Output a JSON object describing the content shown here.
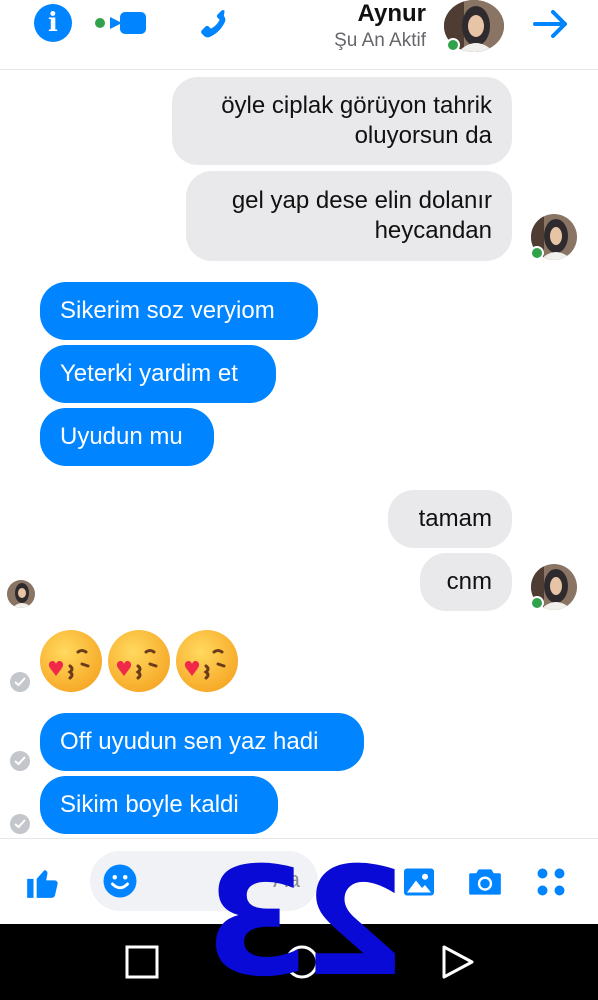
{
  "header": {
    "contact_name": "Aynur",
    "contact_status": "Şu An Aktif"
  },
  "messages": [
    {
      "side": "received",
      "lines": [
        "öyle ciplak görüyon tahrik",
        "oluyorsun da"
      ]
    },
    {
      "side": "received",
      "lines": [
        "gel yap desе elin dolanır",
        "heycandan"
      ]
    },
    {
      "side": "sent",
      "lines": [
        "Sikerim soz veryiom"
      ]
    },
    {
      "side": "sent",
      "lines": [
        "Yeterki yardim et"
      ]
    },
    {
      "side": "sent",
      "lines": [
        "Uyudun mu"
      ]
    },
    {
      "side": "received",
      "lines": [
        "tamam"
      ]
    },
    {
      "side": "received",
      "lines": [
        "cnm"
      ]
    },
    {
      "side": "sent",
      "lines": [
        "Off uyudun sen yaz hadi"
      ]
    },
    {
      "side": "sent",
      "lines": [
        "Sikim boyle kaldi"
      ]
    }
  ],
  "composer": {
    "placeholder": "Aa"
  },
  "overlay_number": "23",
  "colors": {
    "accent": "#0084ff",
    "received_bubble": "#e9e9eb",
    "online": "#31a24c",
    "watermark": "#0a0ad6"
  },
  "icons": [
    "info-icon",
    "video-icon",
    "phone-icon",
    "arrow-icon",
    "like-icon",
    "emoji-icon",
    "gallery-icon",
    "camera-icon",
    "apps-icon"
  ]
}
